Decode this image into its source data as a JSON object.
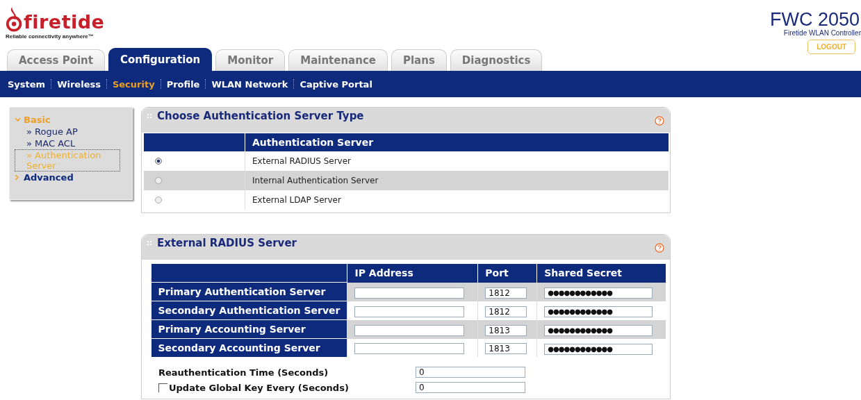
{
  "logo": {
    "name": "firetide",
    "tagline": "Reliable connectivity anywhere™"
  },
  "product": {
    "model": "FWC 2050",
    "subtitle": "Firetide WLAN Controller",
    "logout": "LOGOUT"
  },
  "tabs": [
    {
      "label": "Access Point",
      "selected": false
    },
    {
      "label": "Configuration",
      "selected": true
    },
    {
      "label": "Monitor",
      "selected": false
    },
    {
      "label": "Maintenance",
      "selected": false
    },
    {
      "label": "Plans",
      "selected": false
    },
    {
      "label": "Diagnostics",
      "selected": false
    }
  ],
  "subnav": [
    {
      "label": "System",
      "selected": false
    },
    {
      "label": "Wireless",
      "selected": false
    },
    {
      "label": "Security",
      "selected": true
    },
    {
      "label": "Profile",
      "selected": false
    },
    {
      "label": "WLAN Network",
      "selected": false
    },
    {
      "label": "Captive Portal",
      "selected": false
    }
  ],
  "sidebar": {
    "items": [
      {
        "label": "Basic",
        "expanded": true,
        "children": [
          {
            "label": "» Rogue AP",
            "selected": false
          },
          {
            "label": "» MAC ACL",
            "selected": false
          },
          {
            "label": "» Authentication Server",
            "selected": true
          }
        ]
      },
      {
        "label": "Advanced",
        "expanded": false
      }
    ]
  },
  "auth_type_panel": {
    "title": "Choose Authentication Server Type",
    "columns": [
      "Authentication Server"
    ],
    "rows": [
      {
        "label": "External RADIUS Server",
        "selected": true
      },
      {
        "label": "Internal Authentication Server",
        "selected": false
      },
      {
        "label": "External LDAP Server",
        "selected": false
      }
    ]
  },
  "radius_panel": {
    "title": "External RADIUS Server",
    "columns": [
      "IP Address",
      "Port",
      "Shared Secret"
    ],
    "rows": [
      {
        "label": "Primary Authentication Server",
        "port": "1812",
        "secret": "●●●●●●●●●●●●"
      },
      {
        "label": "Secondary Authentication Server",
        "port": "1812",
        "secret": "●●●●●●●●●●●●"
      },
      {
        "label": "Primary Accounting Server",
        "port": "1813",
        "secret": "●●●●●●●●●●●●"
      },
      {
        "label": "Secondary Accounting Server",
        "port": "1813",
        "secret": "●●●●●●●●●●●●"
      }
    ],
    "settings": [
      {
        "label": "Reauthentication Time (Seconds)",
        "value": "0",
        "kind": "plain"
      },
      {
        "label": "Update Global Key Every (Seconds)",
        "value": "0",
        "kind": "checkbox",
        "checked": false
      }
    ]
  }
}
